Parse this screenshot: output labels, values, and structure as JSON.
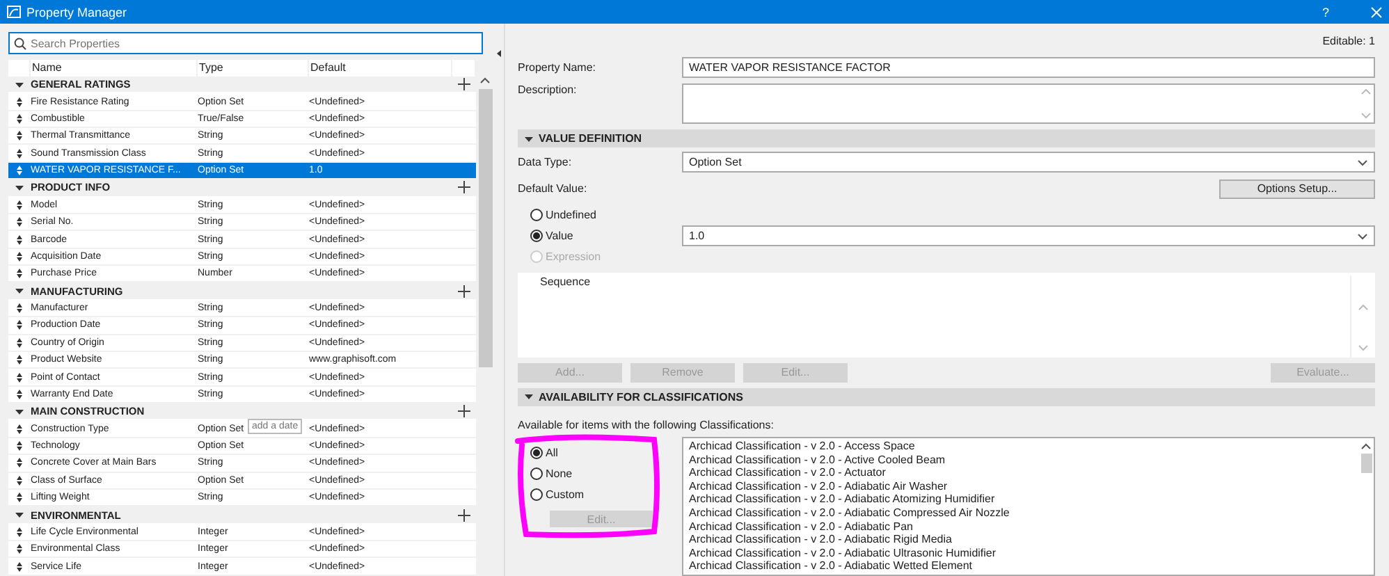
{
  "window": {
    "title": "Property Manager",
    "help": "?"
  },
  "search": {
    "placeholder": "Search Properties"
  },
  "columns": [
    "Name",
    "Type",
    "Default"
  ],
  "groups": [
    {
      "name": "GENERAL RATINGS",
      "expanded": true,
      "properties": [
        {
          "name": "Fire Resistance Rating",
          "type": "Option Set",
          "default": "<Undefined>",
          "selected": false
        },
        {
          "name": "Combustible",
          "type": "True/False",
          "default": "<Undefined>",
          "selected": false
        },
        {
          "name": "Thermal Transmittance",
          "type": "String",
          "default": "<Undefined>",
          "selected": false
        },
        {
          "name": "Sound Transmission Class",
          "type": "String",
          "default": "<Undefined>",
          "selected": false
        },
        {
          "name": "WATER VAPOR RESISTANCE F...",
          "type": "Option Set",
          "default": "1.0",
          "selected": true
        }
      ]
    },
    {
      "name": "PRODUCT INFO",
      "expanded": true,
      "properties": [
        {
          "name": "Model",
          "type": "String",
          "default": "<Undefined>",
          "selected": false
        },
        {
          "name": "Serial No.",
          "type": "String",
          "default": "<Undefined>",
          "selected": false
        },
        {
          "name": "Barcode",
          "type": "String",
          "default": "<Undefined>",
          "selected": false
        },
        {
          "name": "Acquisition Date",
          "type": "String",
          "default": "<Undefined>",
          "selected": false
        },
        {
          "name": "Purchase Price",
          "type": "Number",
          "default": "<Undefined>",
          "selected": false
        }
      ]
    },
    {
      "name": "MANUFACTURING",
      "expanded": true,
      "properties": [
        {
          "name": "Manufacturer",
          "type": "String",
          "default": "<Undefined>",
          "selected": false
        },
        {
          "name": "Production Date",
          "type": "String",
          "default": "<Undefined>",
          "selected": false
        },
        {
          "name": "Country of Origin",
          "type": "String",
          "default": "<Undefined>",
          "selected": false
        },
        {
          "name": "Product Website",
          "type": "String",
          "default": "www.graphisoft.com",
          "selected": false
        },
        {
          "name": "Point of Contact",
          "type": "String",
          "default": "<Undefined>",
          "selected": false
        },
        {
          "name": "Warranty End Date",
          "type": "String",
          "default": "<Undefined>",
          "selected": false
        }
      ]
    },
    {
      "name": "MAIN CONSTRUCTION",
      "expanded": true,
      "properties": [
        {
          "name": "Construction Type",
          "type": "Option Set",
          "default": "<Undefined>",
          "selected": false
        },
        {
          "name": "Technology",
          "type": "Option Set",
          "default": "<Undefined>",
          "selected": false
        },
        {
          "name": "Concrete Cover at Main Bars",
          "type": "String",
          "default": "<Undefined>",
          "selected": false
        },
        {
          "name": "Class of Surface",
          "type": "Option Set",
          "default": "<Undefined>",
          "selected": false
        },
        {
          "name": "Lifting Weight",
          "type": "String",
          "default": "<Undefined>",
          "selected": false
        }
      ]
    },
    {
      "name": "ENVIRONMENTAL",
      "expanded": true,
      "properties": [
        {
          "name": "Life Cycle Environmental",
          "type": "Integer",
          "default": "<Undefined>",
          "selected": false
        },
        {
          "name": "Environmental Class",
          "type": "Integer",
          "default": "<Undefined>",
          "selected": false
        },
        {
          "name": "Service Life",
          "type": "Integer",
          "default": "<Undefined>",
          "selected": false
        }
      ]
    }
  ],
  "tooltip": "add a date",
  "details": {
    "editable": "Editable: 1",
    "property_name": {
      "label": "Property Name:",
      "value": "WATER VAPOR RESISTANCE FACTOR"
    },
    "description": {
      "label": "Description:"
    },
    "value_definition": {
      "title": "VALUE DEFINITION",
      "expanded": true,
      "data_type": {
        "label": "Data Type:",
        "value": "Option Set"
      },
      "default_label": "Default Value:",
      "options_button": "Options Setup...",
      "choices": [
        {
          "label": "Undefined",
          "selected": false,
          "disabled": false
        },
        {
          "label": "Value",
          "selected": true,
          "disabled": false
        },
        {
          "label": "Expression",
          "selected": false,
          "disabled": true
        }
      ],
      "value": "1.0",
      "sequence_header": "Sequence",
      "buttons": [
        {
          "label": "Add...",
          "disabled": true
        },
        {
          "label": "Remove",
          "disabled": true
        },
        {
          "label": "Edit...",
          "disabled": true
        },
        {
          "label": "Evaluate...",
          "disabled": true
        }
      ]
    },
    "availability": {
      "title": "AVAILABILITY FOR CLASSIFICATIONS",
      "expanded": true,
      "caption": "Available for items with the following Classifications:",
      "choices": [
        {
          "label": "All",
          "selected": true,
          "disabled": false
        },
        {
          "label": "None",
          "selected": false,
          "disabled": false
        },
        {
          "label": "Custom",
          "selected": false,
          "disabled": false
        }
      ],
      "edit_button": {
        "label": "Edit...",
        "disabled": true
      },
      "classifications": [
        "Archicad Classification - v 2.0 - Access Space",
        "Archicad Classification - v 2.0 - Active Cooled Beam",
        "Archicad Classification - v 2.0 - Actuator",
        "Archicad Classification - v 2.0 - Adiabatic Air Washer",
        "Archicad Classification - v 2.0 - Adiabatic Atomizing Humidifier",
        "Archicad Classification - v 2.0 - Adiabatic Compressed Air Nozzle",
        "Archicad Classification - v 2.0 - Adiabatic Pan",
        "Archicad Classification - v 2.0 - Adiabatic Rigid Media",
        "Archicad Classification - v 2.0 - Adiabatic Ultrasonic Humidifier",
        "Archicad Classification - v 2.0 - Adiabatic Wetted Element"
      ]
    }
  }
}
